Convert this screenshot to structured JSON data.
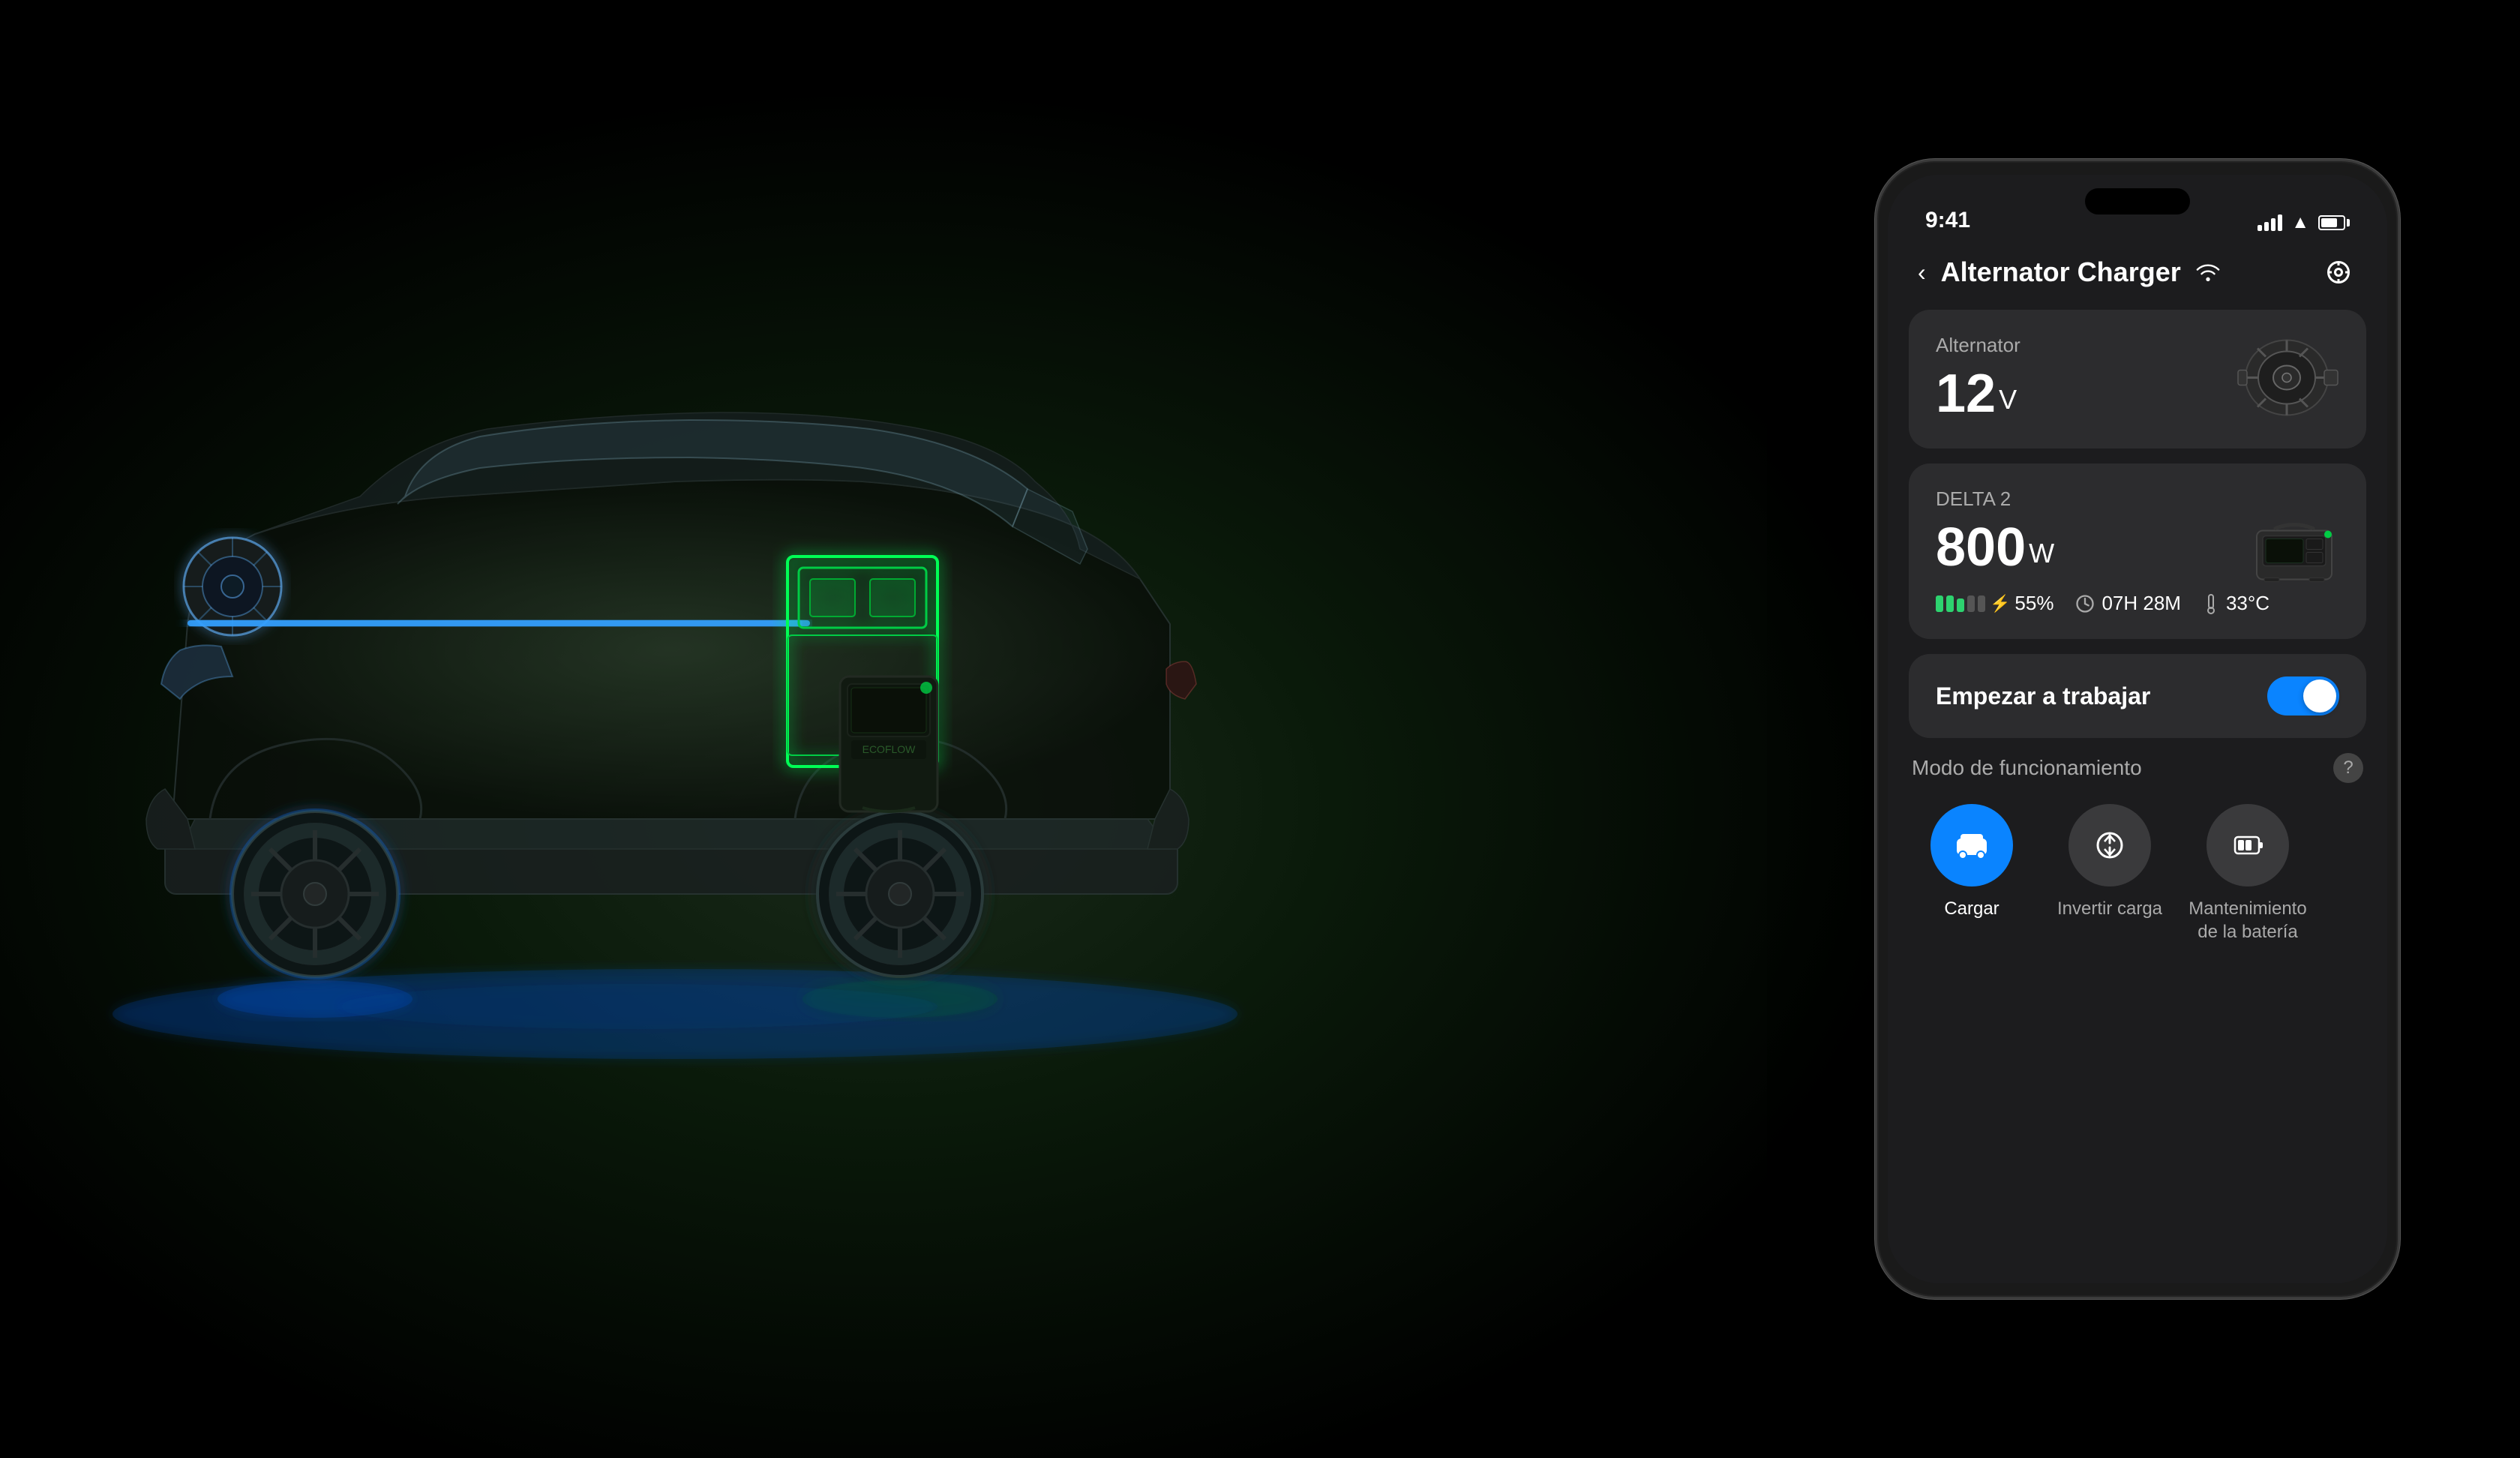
{
  "background": {
    "color": "#000000"
  },
  "status_bar": {
    "time": "9:41",
    "signal_bars": 4,
    "wifi": true,
    "battery_percent": 75
  },
  "header": {
    "back_label": "‹",
    "title": "Alternator Charger",
    "wifi_icon": "wifi",
    "settings_icon": "target"
  },
  "alternator_card": {
    "label": "Alternator",
    "value": "12",
    "unit": "V",
    "icon": "alternator"
  },
  "delta2_card": {
    "label": "DELTA 2",
    "value": "800",
    "unit": "W",
    "icon": "delta2",
    "battery_percent": "55%",
    "time_remaining": "07H 28M",
    "temperature": "33°C"
  },
  "toggle_section": {
    "label": "Empezar a trabajar",
    "enabled": true
  },
  "mode_section": {
    "title": "Modo de funcionamiento",
    "help_icon": "?",
    "modes": [
      {
        "id": "cargar",
        "icon": "🚗",
        "label": "Cargar",
        "active": true
      },
      {
        "id": "invertir",
        "icon": "⚡",
        "label": "Invertir carga",
        "active": false
      },
      {
        "id": "mantenimiento",
        "icon": "🔋",
        "label": "Mantenimiento de la batería",
        "active": false
      }
    ]
  },
  "car": {
    "has_visualization": true,
    "alternator_glow": "blue",
    "battery_glow": "green"
  }
}
